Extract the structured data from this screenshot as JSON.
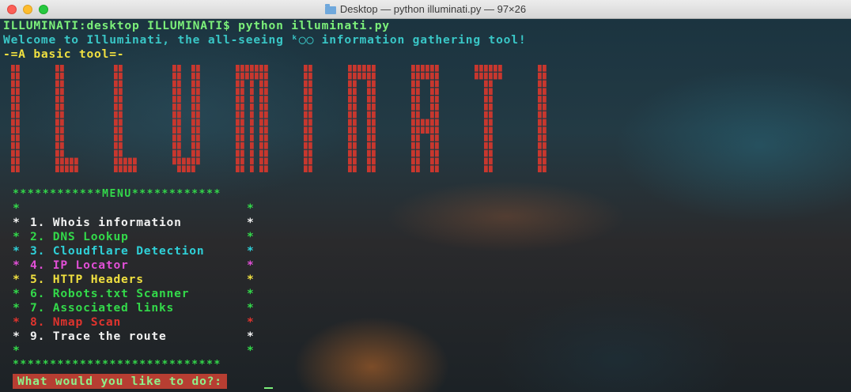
{
  "window": {
    "title": "Desktop — python illuminati.py — 97×26"
  },
  "terminal": {
    "prompt_line": "ILLUMINATI:desktop ILLUMINATI$ python illuminati.py",
    "welcome_line": "Welcome to Illuminati, the all-seeing ᵏ◯◯ information gathering tool!",
    "subtitle": "-=A basic tool=-",
    "banner_text": "ILLUMINATI",
    "colors": {
      "prompt": "#7cf07a",
      "welcome": "#39c6c6",
      "subtitle": "#f0e040",
      "banner": "#c8372e",
      "menu_border": "#33d94a",
      "input_bg": "#b73e32"
    },
    "menu": {
      "top_border": "************MENU************",
      "bottom_border": "****************************",
      "items": [
        {
          "label": "1. Whois information",
          "color": "#f2f2f2"
        },
        {
          "label": "2. DNS Lookup",
          "color": "#33d94a"
        },
        {
          "label": "3. Cloudflare Detection",
          "color": "#2fd0d8"
        },
        {
          "label": "4. IP Locator",
          "color": "#e14fd6"
        },
        {
          "label": "5. HTTP Headers",
          "color": "#f0e040"
        },
        {
          "label": "6. Robots.txt Scanner",
          "color": "#33d94a"
        },
        {
          "label": "7. Associated links",
          "color": "#33d94a"
        },
        {
          "label": "8. Nmap Scan",
          "color": "#e0342e"
        },
        {
          "label": "9. Trace the route",
          "color": "#f2f2f2"
        }
      ]
    },
    "input_prompt": "What would you like to do?:"
  }
}
